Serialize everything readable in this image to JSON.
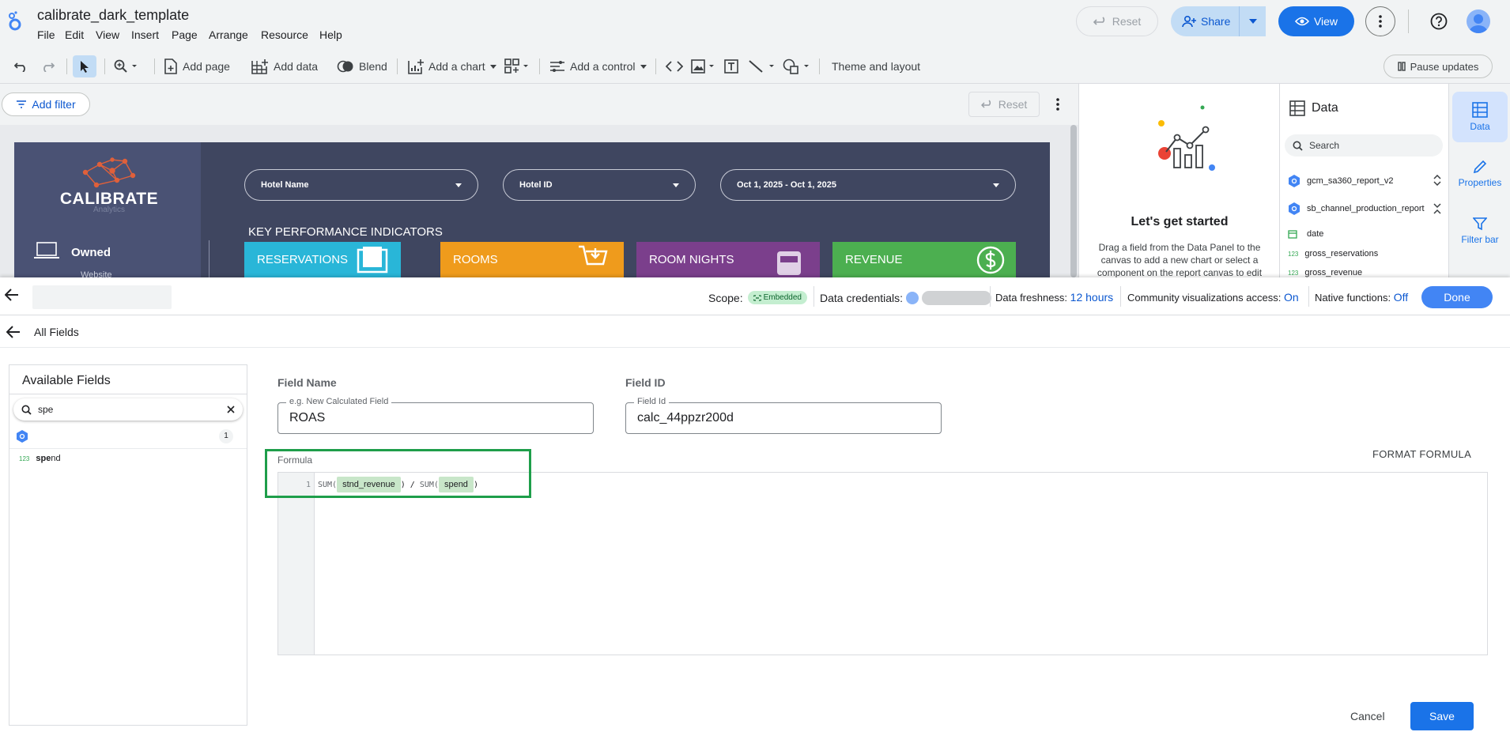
{
  "app": {
    "doc_title": "calibrate_dark_template",
    "menu": [
      "File",
      "Edit",
      "View",
      "Insert",
      "Page",
      "Arrange",
      "Resource",
      "Help"
    ],
    "reset_label": "Reset",
    "share_label": "Share",
    "view_label": "View"
  },
  "toolbar": {
    "add_page": "Add page",
    "add_data": "Add data",
    "blend": "Blend",
    "add_chart": "Add a chart",
    "add_control": "Add a control",
    "theme_layout": "Theme and layout",
    "pause_updates": "Pause updates"
  },
  "filterbar": {
    "add_filter": "Add filter",
    "reset": "Reset"
  },
  "report": {
    "logo_text": "CALIBRATE",
    "logo_sub": "Analytics",
    "owned": "Owned",
    "website": "Website",
    "filters": [
      "Hotel Name",
      "Hotel ID",
      "Oct 1, 2025 - Oct 1, 2025"
    ],
    "kpi_heading": "KEY PERFORMANCE INDICATORS",
    "kpis": [
      {
        "label": "RESERVATIONS",
        "color": "#29b6d8"
      },
      {
        "label": "ROOMS",
        "color": "#ef9b1c"
      },
      {
        "label": "ROOM NIGHTS",
        "color": "#7b3f8c"
      },
      {
        "label": "REVENUE",
        "color": "#4caf50"
      }
    ]
  },
  "start_panel": {
    "title": "Let's get started",
    "body": "Drag a field from the Data Panel to the canvas to add a new chart or select a component on the report canvas to edit"
  },
  "data_panel": {
    "title": "Data",
    "search_placeholder": "Search",
    "sources": [
      "gcm_sa360_report_v2",
      "sb_channel_production_report"
    ],
    "fields": [
      {
        "type": "date",
        "name": "date"
      },
      {
        "type": "123",
        "name": "gross_reservations"
      },
      {
        "type": "123",
        "name": "gross_revenue"
      }
    ]
  },
  "rail": {
    "data": "Data",
    "properties": "Properties",
    "filter_bar": "Filter bar"
  },
  "editor": {
    "scope_label": "Scope:",
    "scope_value": "Embedded",
    "credentials_label": "Data credentials:",
    "freshness_label": "Data freshness:",
    "freshness_value": "12 hours",
    "community_label": "Community visualizations access:",
    "community_value": "On",
    "native_label": "Native functions:",
    "native_value": "Off",
    "done_label": "Done",
    "breadcrumb": "All Fields",
    "available_fields_title": "Available Fields",
    "search_value": "spe",
    "source_count": "1",
    "field_type": "123",
    "field_match": "spe",
    "field_rest": "nd",
    "field_name_label": "Field Name",
    "field_name_legend": "e.g. New Calculated Field",
    "field_name_value": "ROAS",
    "field_id_label": "Field ID",
    "field_id_legend": "Field Id",
    "field_id_value": "calc_44ppzr200d",
    "formula_label": "Formula",
    "format_formula": "FORMAT FORMULA",
    "line_number": "1",
    "formula": {
      "fn1": "SUM(",
      "arg1": "stnd_revenue",
      "mid": ") / ",
      "fn2": "SUM(",
      "arg2": "spend",
      "end": ")"
    },
    "cancel_label": "Cancel",
    "save_label": "Save"
  },
  "colors": {
    "accent": "#1a73e8",
    "highlight_box": "#1e9e4a",
    "chip": "#c8e6c9"
  }
}
